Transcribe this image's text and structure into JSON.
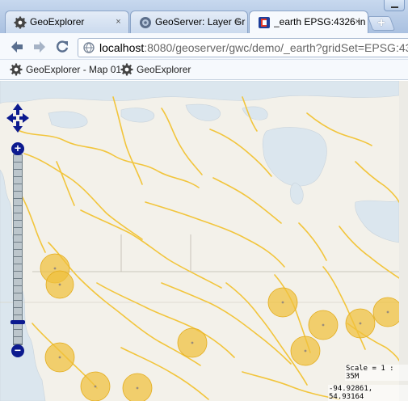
{
  "browser": {
    "tabs": [
      {
        "title": "GeoExplorer",
        "icon": "geoexplorer-gear-icon",
        "active": false
      },
      {
        "title": "GeoServer: Layer Gr",
        "icon": "geoserver-icon",
        "active": false
      },
      {
        "title": "_earth EPSG:4326 in",
        "icon": "openlayers-icon",
        "active": true
      }
    ],
    "new_tab_label": "+",
    "close_glyph": "×",
    "url": {
      "host": "localhost",
      "rest": ":8080/geoserver/gwc/demo/_earth?gridSet=EPSG:43"
    },
    "bookmarks": [
      {
        "label": "GeoExplorer - Map 01",
        "icon": "geoexplorer-gear-icon"
      },
      {
        "label": "GeoExplorer",
        "icon": "geoexplorer-gear-icon"
      }
    ]
  },
  "map": {
    "zoom_in_label": "+",
    "zoom_out_label": "−",
    "zoom_level_fraction": 0.12,
    "scale": "Scale = 1 : 35M",
    "coordinates": "-94.92861, 54.93164",
    "colors": {
      "rivers": "#f2c53c",
      "land": "#f3f1ea",
      "water": "#dbe6ee",
      "circles": "#f0c03c",
      "controls": "#0c1a8f"
    }
  }
}
